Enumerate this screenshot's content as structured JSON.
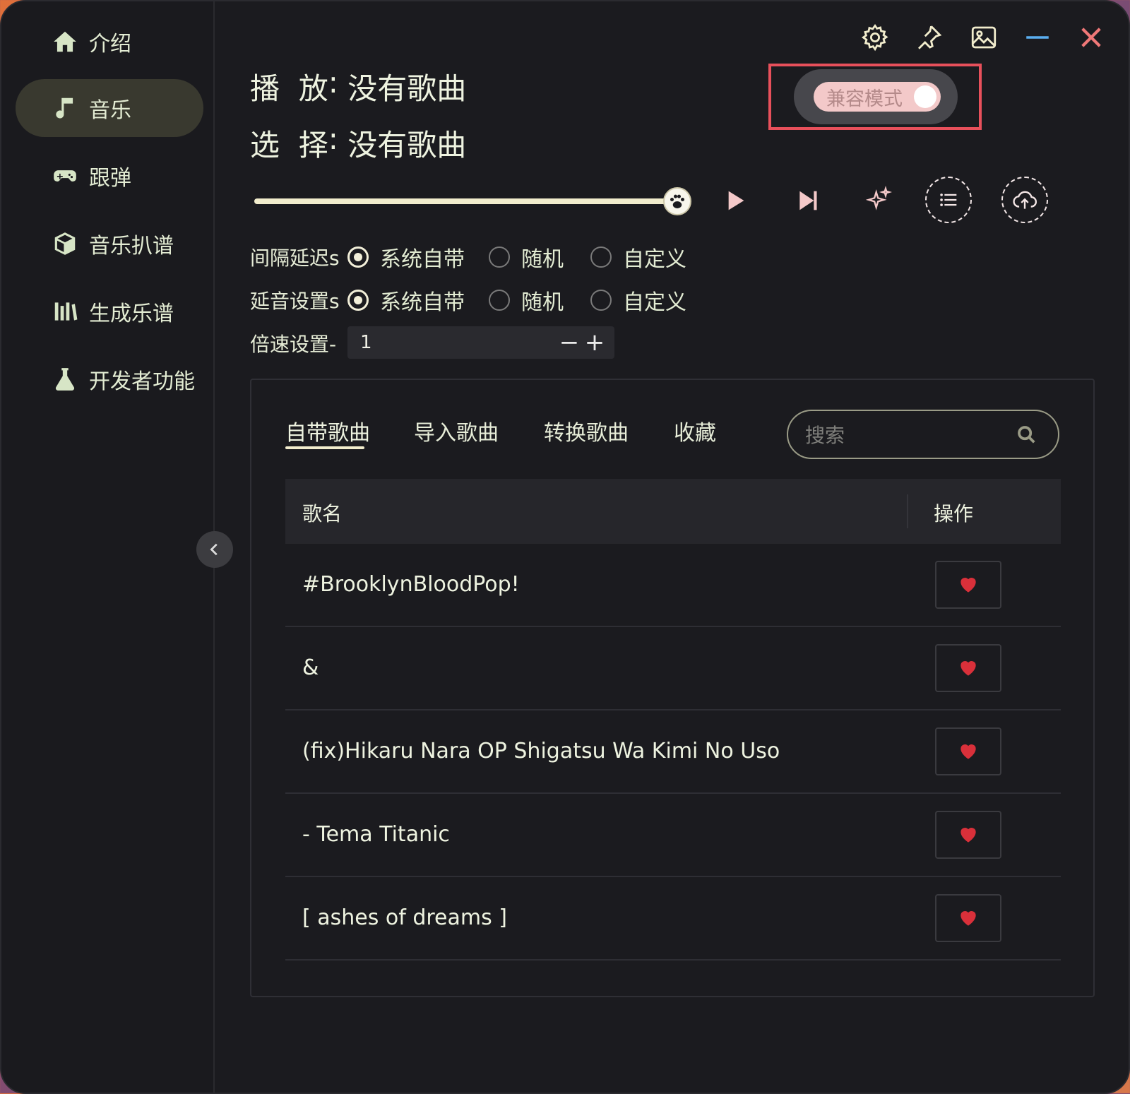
{
  "sidebar": {
    "items": [
      {
        "label": "介绍",
        "icon": "home-icon"
      },
      {
        "label": "音乐",
        "icon": "music-note-icon"
      },
      {
        "label": "跟弹",
        "icon": "gamepad-icon"
      },
      {
        "label": "音乐扒谱",
        "icon": "cube-icon"
      },
      {
        "label": "生成乐谱",
        "icon": "bars-icon"
      },
      {
        "label": "开发者功能",
        "icon": "flask-icon"
      }
    ],
    "active_index": 1
  },
  "topbar": {
    "icons": [
      "gear-icon",
      "pin-icon",
      "image-icon",
      "minimize-icon",
      "close-icon"
    ]
  },
  "compat": {
    "label": "兼容模式",
    "enabled": true
  },
  "player": {
    "playing_label": "播  放",
    "playing_value": "没有歌曲",
    "selected_label": "选  择",
    "selected_value": "没有歌曲",
    "progress": 1.0
  },
  "settings": {
    "interval_label": "间隔延迟s",
    "delay_label": "延音设置s",
    "speed_label": "倍速设置-",
    "options": [
      "系统自带",
      "随机",
      "自定义"
    ],
    "interval_selected": 0,
    "delay_selected": 0,
    "speed_value": "1"
  },
  "tabs": [
    {
      "label": "自带歌曲",
      "active": true
    },
    {
      "label": "导入歌曲",
      "active": false
    },
    {
      "label": "转换歌曲",
      "active": false
    },
    {
      "label": "收藏",
      "active": false
    }
  ],
  "search": {
    "placeholder": "搜索"
  },
  "table": {
    "headers": {
      "name": "歌名",
      "action": "操作"
    },
    "rows": [
      {
        "name": "#BrooklynBloodPop!"
      },
      {
        "name": "&"
      },
      {
        "name": "(fix)Hikaru Nara OP Shigatsu Wa Kimi No Uso"
      },
      {
        "name": "- Tema Titanic"
      },
      {
        "name": "[ ashes of dreams ]"
      }
    ]
  },
  "colors": {
    "accent": "#f2edcd",
    "sidebar_text": "#e3ecd3",
    "close": "#f07878",
    "minimize": "#5aaef0",
    "heart": "#d9303a",
    "highlight_box": "#e8505b"
  }
}
